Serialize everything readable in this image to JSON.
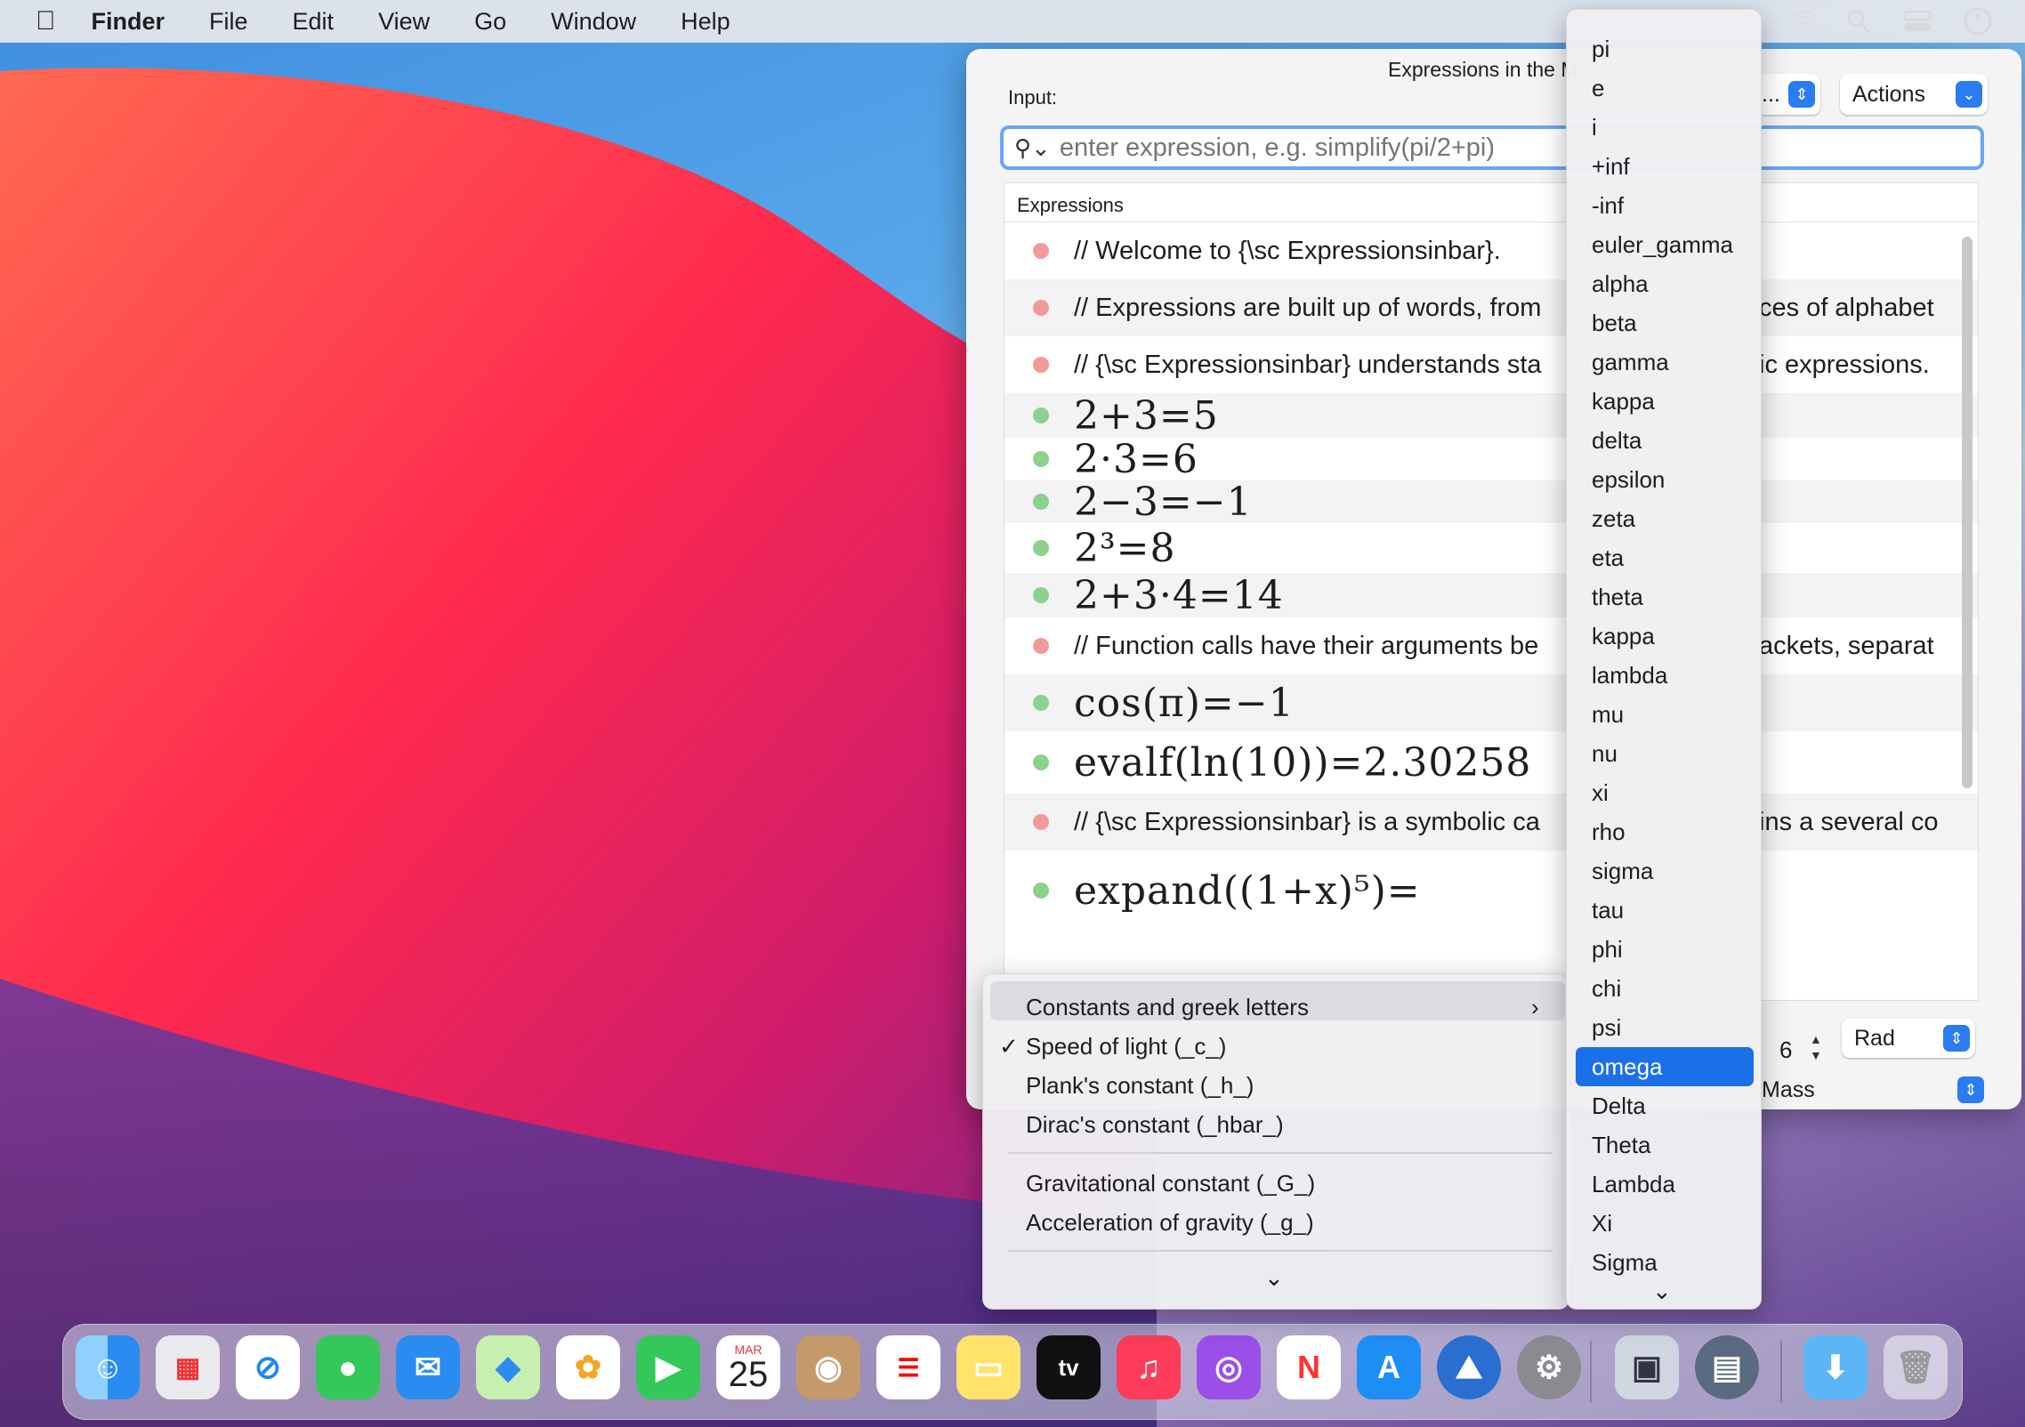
{
  "menubar": {
    "finder": "Finder",
    "file": "File",
    "edit": "Edit",
    "view": "View",
    "go": "Go",
    "window": "Window",
    "help": "Help"
  },
  "window": {
    "title": "Expressions in the M",
    "input_label": "Input:",
    "search_placeholder": "enter expression, e.g. simplify(pi/2+pi)",
    "format_popup": "...",
    "actions_label": "Actions",
    "column_header": "Expressions",
    "rows": [
      {
        "kind": "text",
        "status": "error",
        "text": "// Welcome to  {\\sc Expressionsinbar}."
      },
      {
        "kind": "text",
        "status": "error",
        "text": "// Expressions are  built up of words, from",
        "text_right": "ces of alphabet"
      },
      {
        "kind": "text",
        "status": "error",
        "text": "// {\\sc Expressionsinbar} understands sta",
        "text_right": "ic expressions."
      },
      {
        "kind": "math",
        "status": "ok",
        "text": "2+3=5"
      },
      {
        "kind": "math",
        "status": "ok",
        "text": "2·3=6"
      },
      {
        "kind": "math",
        "status": "ok",
        "text": "2−3=−1"
      },
      {
        "kind": "math",
        "status": "ok",
        "text": "2³=8"
      },
      {
        "kind": "math",
        "status": "ok",
        "text": "2+3·4=14"
      },
      {
        "kind": "text",
        "status": "error",
        "text": "// Function calls have their arguments be",
        "text_right": "ackets, separat"
      },
      {
        "kind": "math",
        "status": "ok",
        "text": "cos(π)=−1"
      },
      {
        "kind": "math",
        "status": "ok",
        "text": "evalf(ln(10))=2.30258"
      },
      {
        "kind": "text",
        "status": "error",
        "text": "// {\\sc Expressionsinbar} is a symbolic ca",
        "text_right": "ins a several co"
      },
      {
        "kind": "math",
        "status": "ok",
        "text": "expand((1+x)⁵)="
      }
    ],
    "precision_value": "6",
    "angle_unit": "Rad",
    "unit_category": "Mass"
  },
  "units_menu": {
    "items": [
      {
        "label": "Constants and greek letters",
        "submenu": true
      },
      {
        "label": "Speed of light (_c_)",
        "checked": true
      },
      {
        "label": "Plank's constant (_h_)"
      },
      {
        "label": "Dirac's constant (_hbar_)"
      },
      {
        "label": "Gravitational constant (_G_)"
      },
      {
        "label": "Acceleration of gravity (_g_)"
      }
    ],
    "more_arrow": "⌄"
  },
  "greek_menu": {
    "items": [
      "pi",
      "e",
      "i",
      "+inf",
      "-inf",
      "euler_gamma",
      "alpha",
      "beta",
      "gamma",
      "kappa",
      "delta",
      "epsilon",
      "zeta",
      "eta",
      "theta",
      "kappa",
      "lambda",
      "mu",
      "nu",
      "xi",
      "rho",
      "sigma",
      "tau",
      "phi",
      "chi",
      "psi",
      "omega",
      "Delta",
      "Theta",
      "Lambda",
      "Xi",
      "Sigma"
    ],
    "selected": "omega",
    "more_arrow": "⌄"
  },
  "dock": {
    "calendar_month": "MAR",
    "calendar_day": "25",
    "tv_label": "tv"
  },
  "colors": {
    "accent": "#1b6fe8",
    "error_dot": "#f29a9a",
    "ok_dot": "#8ed08e"
  }
}
